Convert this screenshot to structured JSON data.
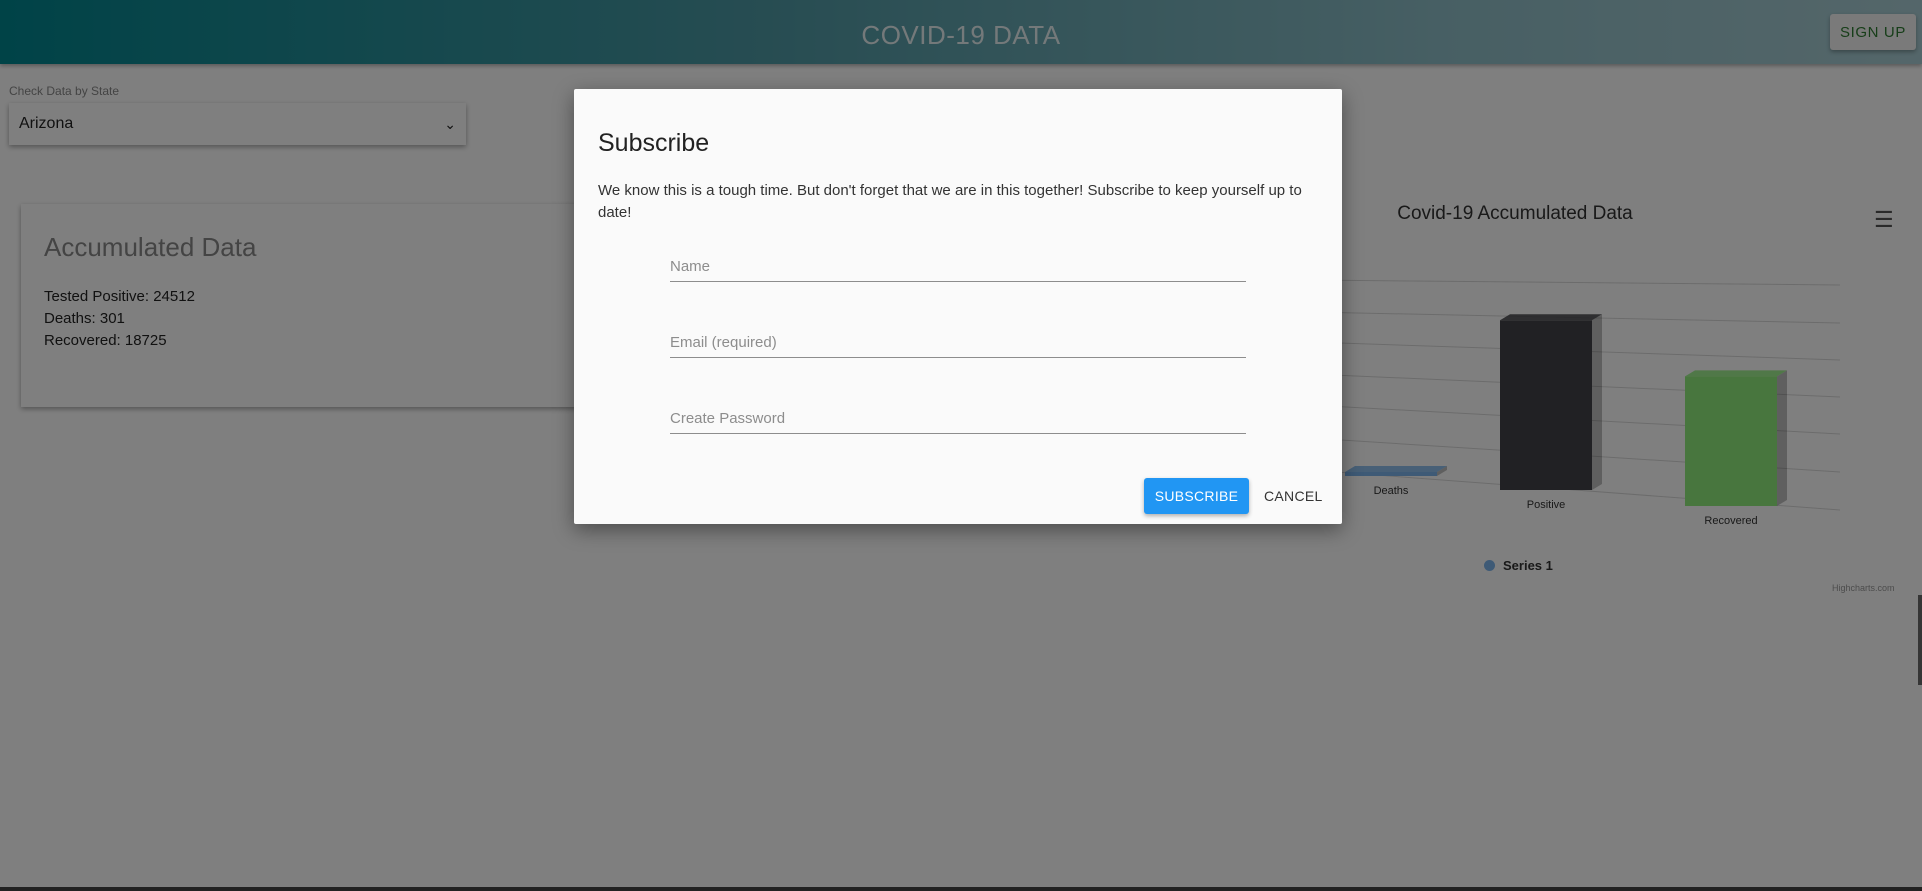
{
  "header": {
    "title": "COVID-19 DATA",
    "signup_label": "SIGN UP"
  },
  "state_selector": {
    "label": "Check Data by State",
    "selected": "Arizona"
  },
  "accumulated_card": {
    "title": "Accumulated Data",
    "tested_positive": "Tested Positive: 24512",
    "deaths": "Deaths: 301",
    "recovered": "Recovered: 18725"
  },
  "chart_data": {
    "type": "bar",
    "title": "Covid-19 Accumulated Data",
    "categories": [
      "Deaths",
      "Positive",
      "Recovered"
    ],
    "series": [
      {
        "name": "Series 1",
        "values": [
          301,
          24512,
          18725
        ],
        "colors": [
          "#7cb5ec",
          "#434348",
          "#90ed7d"
        ]
      }
    ],
    "legend_position": "bottom",
    "credit": "Highcharts.com",
    "grid": true
  },
  "dialog": {
    "title": "Subscribe",
    "message": "We know this is a tough time. But don't forget that we are in this together! Subscribe to keep yourself up to date!",
    "name_placeholder": "Name",
    "email_placeholder": "Email (required)",
    "password_placeholder": "Create Password",
    "subscribe_label": "SUBSCRIBE",
    "cancel_label": "CANCEL"
  },
  "icons": {
    "menu": "hamburger-menu-icon",
    "select_chevron": "chevron-down-icon"
  },
  "colors": {
    "accent": "#2196f3",
    "header_start": "#00868f",
    "signup_text": "#2e7d32"
  }
}
